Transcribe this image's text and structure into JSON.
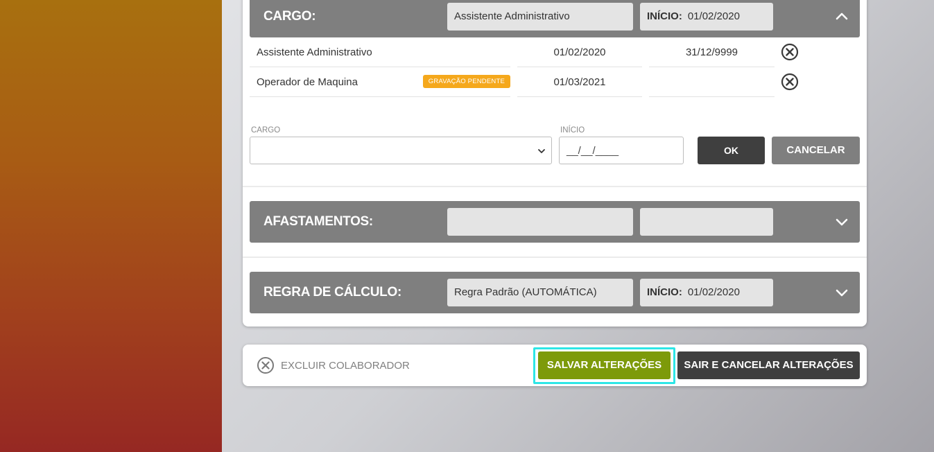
{
  "cargo": {
    "title": "CARGO:",
    "current_name": "Assistente Administrativo",
    "start_label": "INÍCIO:",
    "start_value": "01/02/2020",
    "rows": [
      {
        "name": "Assistente Administrativo",
        "start": "01/02/2020",
        "end": "31/12/9999",
        "badge": ""
      },
      {
        "name": "Operador de Maquina",
        "start": "01/03/2021",
        "end": "",
        "badge": "GRAVAÇÃO PENDENTE"
      }
    ],
    "form": {
      "cargo_label": "CARGO",
      "cargo_value": "",
      "inicio_label": "INÍCIO",
      "inicio_placeholder": "__/__/____",
      "ok_label": "OK",
      "cancel_label": "CANCELAR"
    }
  },
  "afastamentos": {
    "title": "AFASTAMENTOS:",
    "current_name": "",
    "start_value": ""
  },
  "regra": {
    "title": "REGRA DE CÁLCULO:",
    "current_name": "Regra Padrão (AUTOMÁTICA)",
    "start_label": "INÍCIO:",
    "start_value": "01/02/2020"
  },
  "footer": {
    "delete_label": "EXCLUIR COLABORADOR",
    "save_label": "SALVAR ALTERAÇÕES",
    "exit_label": "SAIR E CANCELAR ALTERAÇÕES"
  },
  "colors": {
    "header_bg": "#7f7f7f",
    "save_green": "#7d9a0a",
    "badge_orange": "#f5a81c",
    "focus_cyan": "#2ee6e6"
  }
}
